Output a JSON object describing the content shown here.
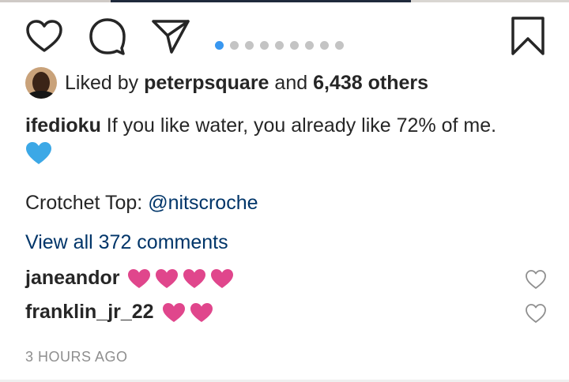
{
  "actions": {
    "like_icon": "heart-outline-icon",
    "comment_icon": "comment-bubble-icon",
    "share_icon": "paper-plane-icon",
    "save_icon": "bookmark-icon"
  },
  "carousel": {
    "total": 9,
    "active_index": 0,
    "active_color": "#3897f0",
    "inactive_color": "#c4c4c4"
  },
  "likes": {
    "prefix": "Liked by",
    "user": "peterpsquare",
    "conjunction": "and",
    "others": "6,438 others"
  },
  "caption": {
    "username": "ifedioku",
    "text": "If you like water, you already like 72% of me.",
    "emoji": "blue-heart",
    "credit_label": "Crotchet Top:",
    "credit_handle": "@nitscroche"
  },
  "comments_link": "View all 372 comments",
  "comments": [
    {
      "username": "janeandor",
      "hearts": 4
    },
    {
      "username": "franklin_jr_22",
      "hearts": 2
    }
  ],
  "timestamp": "3 HOURS AGO",
  "colors": {
    "text": "#262626",
    "link": "#003569",
    "muted": "#8e8e8e",
    "pink_heart": "#e0468c",
    "blue_heart": "#3ca8e6"
  }
}
